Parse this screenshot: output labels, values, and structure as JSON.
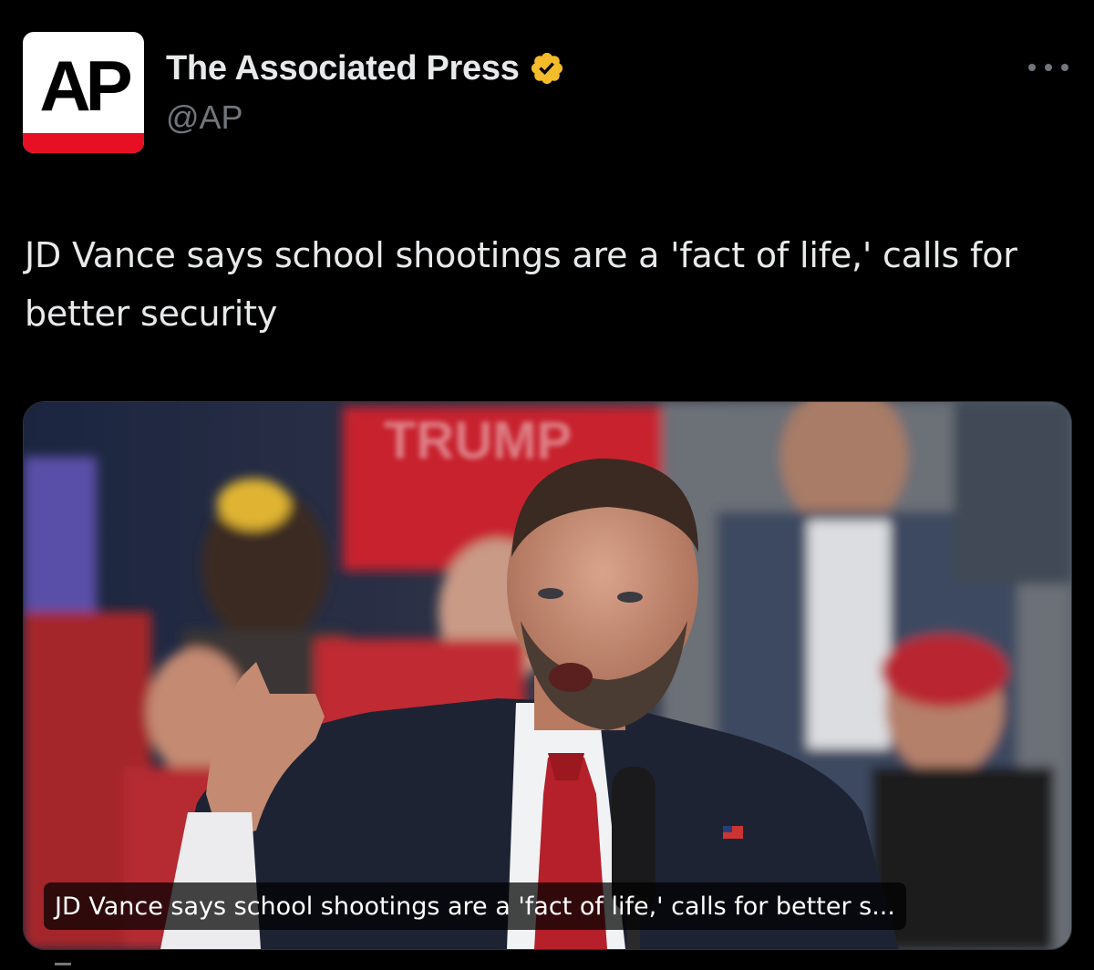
{
  "author": {
    "display_name": "The Associated Press",
    "handle": "@AP",
    "avatar_text": "AP",
    "verified": true,
    "verified_color": "#f4bb2b",
    "logo_bar_color": "#e60f23"
  },
  "post": {
    "text": "JD Vance says school shootings are a 'fact of life,' calls for better security"
  },
  "card": {
    "caption": "JD Vance says school shootings are a 'fact of life,' calls for better s...",
    "sign_text": "TRUMP"
  },
  "icons": {
    "more": "more-horizontal-icon",
    "verified": "verified-badge-icon"
  }
}
